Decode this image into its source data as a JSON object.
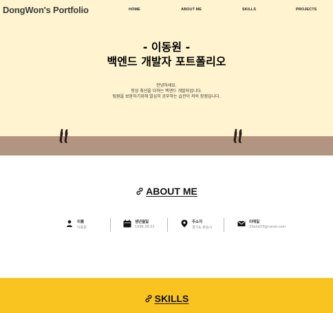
{
  "header": {
    "brand": "DongWon's Portfolio",
    "nav": [
      "HOME",
      "ABOUT ME",
      "SKILLS",
      "PROJECTS"
    ]
  },
  "hero": {
    "title_line1": "- 이동원 -",
    "title_line2": "백엔드 개발자 포트폴리오",
    "desc": [
      "안녕하세요.",
      "항상 최선을 다하는 백엔드 개발자입니다.",
      "팀원을 보완하기위해 열심히 공부하는 습관이 저의 장점입니다."
    ]
  },
  "about": {
    "title": "ABOUT ME",
    "items": [
      {
        "icon": "person-icon",
        "label": "이름",
        "value": "이동원"
      },
      {
        "icon": "calendar-icon",
        "label": "생년월일",
        "value": "1996.09.01"
      },
      {
        "icon": "map-pin-icon",
        "label": "주소지",
        "value": "경기도 화성시"
      },
      {
        "icon": "envelope-icon",
        "label": "이메일",
        "value": "33ehd33@naver.com"
      }
    ]
  },
  "skills": {
    "title": "SKILLS"
  },
  "colors": {
    "hero_bg": "#fff4cf",
    "ground": "#b29580",
    "skills_bg": "#f9c41f"
  }
}
